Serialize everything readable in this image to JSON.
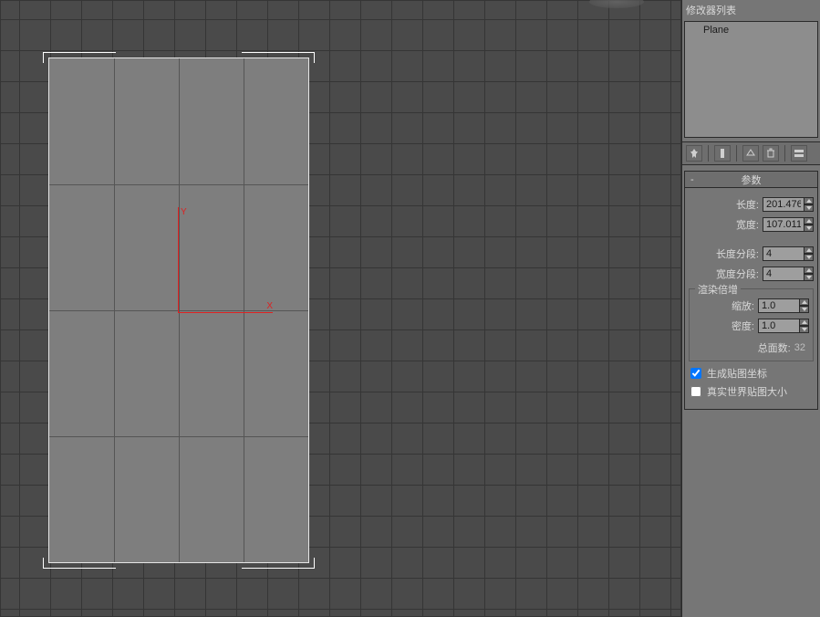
{
  "viewport": {
    "gizmo": {
      "x_label": "X",
      "y_label": "Y"
    }
  },
  "panel": {
    "modifier_list_title": "修改器列表",
    "stack": {
      "item0": "Plane"
    },
    "toolbar": {
      "pin": "pin-icon",
      "show": "show-end-result-icon",
      "unique": "make-unique-icon",
      "remove": "remove-icon",
      "config": "configure-icon"
    },
    "rollout": {
      "title": "参数",
      "length_label": "长度:",
      "length_value": "201.476",
      "width_label": "宽度:",
      "width_value": "107.011",
      "length_segs_label": "长度分段:",
      "length_segs_value": "4",
      "width_segs_label": "宽度分段:",
      "width_segs_value": "4",
      "render_mult_title": "渲染倍增",
      "scale_label": "缩放:",
      "scale_value": "1.0",
      "density_label": "密度:",
      "density_value": "1.0",
      "total_faces_label": "总面数:",
      "total_faces_value": "32",
      "gen_uv_label": "生成贴图坐标",
      "real_world_label": "真实世界贴图大小"
    }
  }
}
